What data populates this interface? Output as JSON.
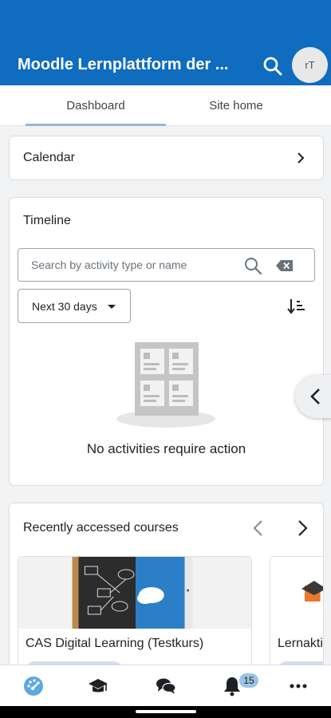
{
  "app": {
    "title": "Moodle Lernplattform der ...",
    "avatar_initials": "rT",
    "brand_color": "#0f6cbf"
  },
  "tabs": [
    {
      "label": "Dashboard",
      "selected": true
    },
    {
      "label": "Site home",
      "selected": false
    }
  ],
  "calendar": {
    "title": "Calendar"
  },
  "timeline": {
    "title": "Timeline",
    "search_placeholder": "Search by activity type or name",
    "filter_label": "Next 30 days",
    "empty_message": "No activities require action"
  },
  "recent_courses": {
    "title": "Recently accessed courses",
    "courses": [
      {
        "name": "CAS Digital Learning (Testkurs)"
      },
      {
        "name": "Lernakti"
      }
    ]
  },
  "bottom_nav": {
    "items": [
      "dashboard-icon",
      "courses-icon",
      "messages-icon",
      "notifications-icon",
      "more-icon"
    ],
    "notifications_count": "15"
  }
}
